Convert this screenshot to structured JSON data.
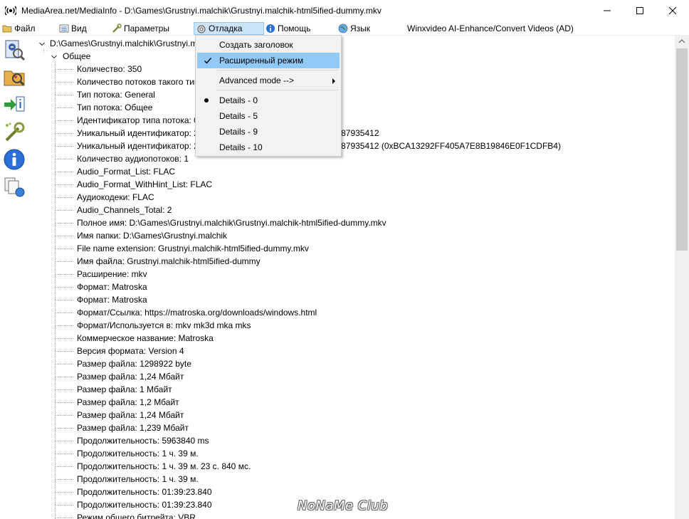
{
  "window": {
    "title": "MediaArea.net/MediaInfo - D:\\Games\\Grustnyi.malchik\\Grustnyi.malchik-html5ified-dummy.mkv"
  },
  "menu": {
    "file": "Файл",
    "view": "Вид",
    "params": "Параметры",
    "debug": "Отладка",
    "help": "Помощь",
    "lang": "Язык",
    "ad": "Winxvideo AI-Enhance/Convert Videos (AD)"
  },
  "dropdown": {
    "create_header": "Создать заголовок",
    "extended_mode": "Расширенный режим",
    "advanced_mode": "Advanced mode -->",
    "details0": "Details - 0",
    "details5": "Details - 5",
    "details9": "Details - 9",
    "details10": "Details - 10"
  },
  "tree": {
    "root": "D:\\Games\\Grustnyi.malchik\\Grustnyi.malchik-html5ified-dummy.mkv",
    "section": "Общее",
    "items": [
      "Количество: 350",
      "Количество потоков такого типа: 1",
      "Тип потока: General",
      "Тип потока: Общее",
      "Идентификатор типа потока: 0",
      "Уникальный идентификатор: 250839263803103823300013960963087935412",
      "Уникальный идентификатор: 250839263803103823300013960963087935412 (0xBCA13292FF405A7E8B19846E0F1CDFB4)",
      "Количество аудиопотоков: 1",
      "Audio_Format_List: FLAC",
      "Audio_Format_WithHint_List: FLAC",
      "Аудиокодеки: FLAC",
      "Audio_Channels_Total: 2",
      "Полное имя: D:\\Games\\Grustnyi.malchik\\Grustnyi.malchik-html5ified-dummy.mkv",
      "Имя папки: D:\\Games\\Grustnyi.malchik",
      "File name extension: Grustnyi.malchik-html5ified-dummy.mkv",
      "Имя файла: Grustnyi.malchik-html5ified-dummy",
      "Расширение: mkv",
      "Формат: Matroska",
      "Формат: Matroska",
      "Формат/Ссылка: https://matroska.org/downloads/windows.html",
      "Формат/Используется в: mkv mk3d mka mks",
      "Коммерческое название: Matroska",
      "Версия формата: Version 4",
      "Размер файла: 1298922 byte",
      "Размер файла: 1,24 Мбайт",
      "Размер файла: 1 Мбайт",
      "Размер файла: 1,2 Мбайт",
      "Размер файла: 1,24 Мбайт",
      "Размер файла: 1,239 Мбайт",
      "Продолжительность: 5963840 ms",
      "Продолжительность: 1 ч. 39 м.",
      "Продолжительность: 1 ч. 39 м. 23 с. 840 мс.",
      "Продолжительность: 1 ч. 39 м.",
      "Продолжительность: 01:39:23.840",
      "Продолжительность: 01:39:23.840",
      "Режим общего битрейта: VBR"
    ]
  },
  "watermark": "NoNaMe Club"
}
